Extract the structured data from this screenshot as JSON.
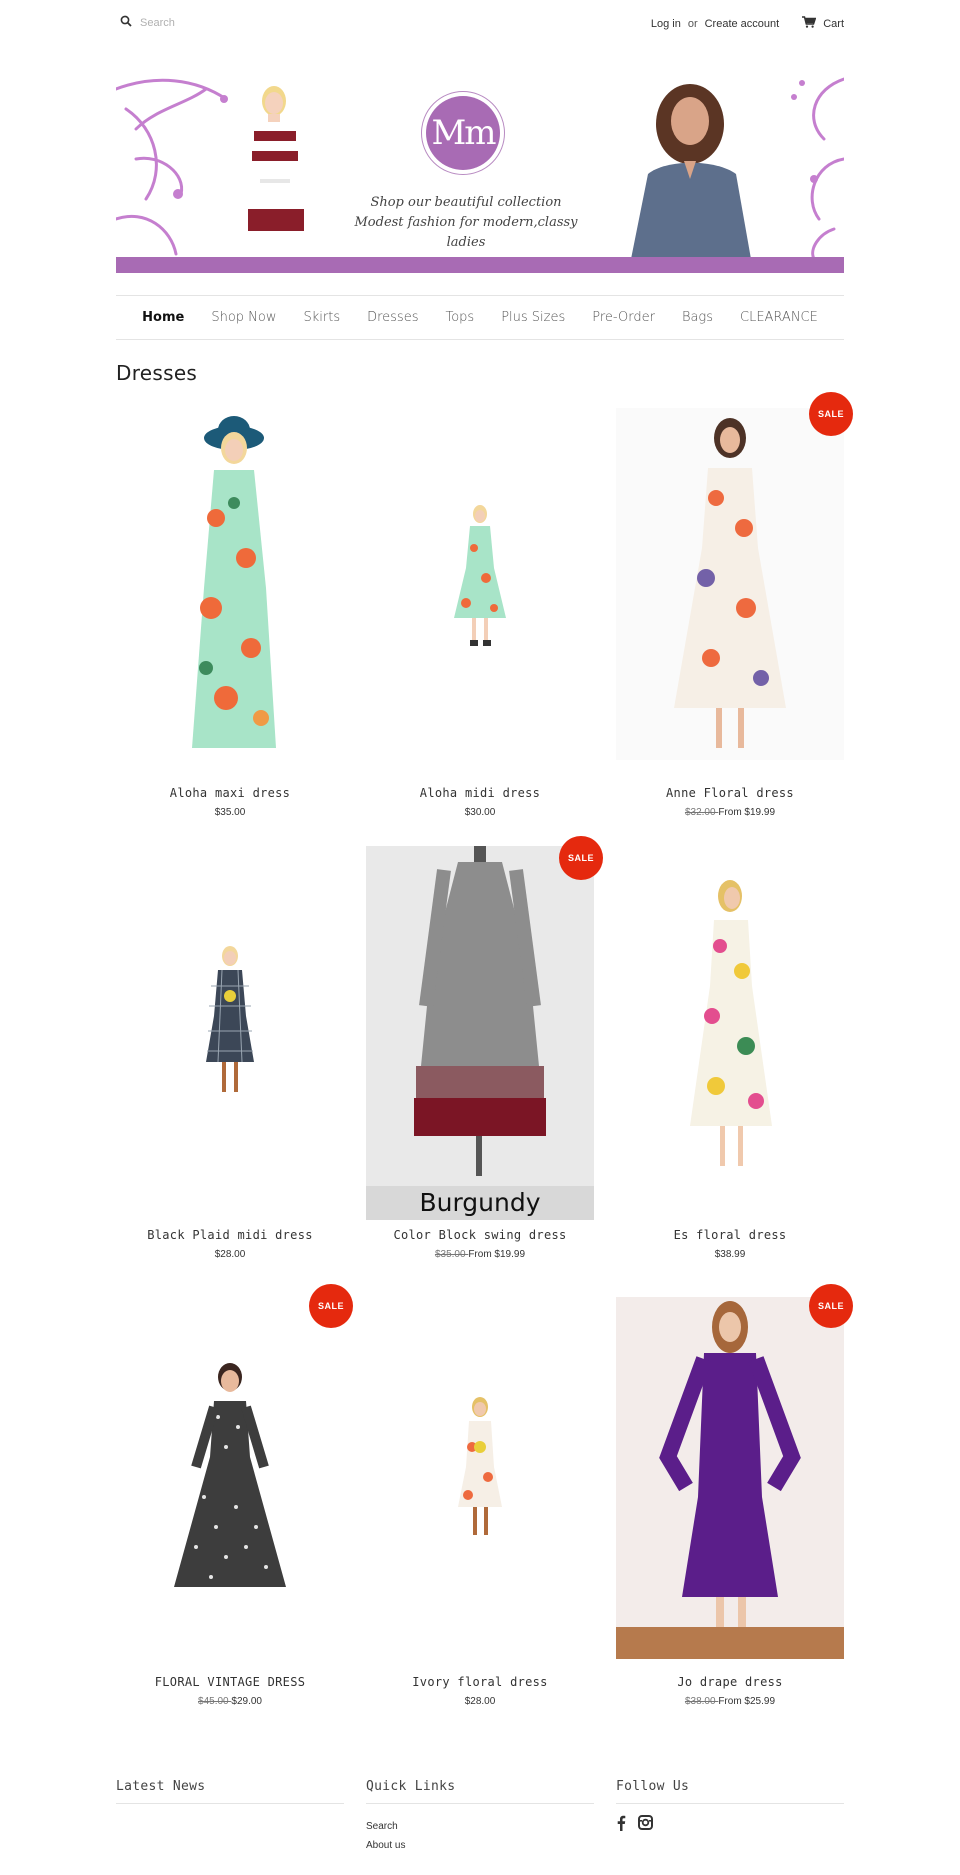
{
  "header": {
    "search_placeholder": "Search",
    "login": "Log in",
    "or": "or",
    "create_account": "Create account",
    "cart": "Cart"
  },
  "banner": {
    "logo_text": "Mm",
    "tagline_1": "Shop our beautiful collection",
    "tagline_2": "Modest fashion for modern,classy ladies",
    "accent": "#a86bb4"
  },
  "nav": {
    "items": [
      "Home",
      "Shop Now",
      "Skirts",
      "Dresses",
      "Tops",
      "Plus Sizes",
      "Pre-Order",
      "Bags",
      "CLEARANCE"
    ],
    "active": "Home"
  },
  "page_title": "Dresses",
  "sale_badge": "SALE",
  "sale_color": "#e5290e",
  "products": [
    {
      "name": "Aloha maxi dress",
      "price": "$35.00",
      "compare": "",
      "sale": false
    },
    {
      "name": "Aloha midi dress",
      "price": "$30.00",
      "compare": "",
      "sale": false
    },
    {
      "name": "Anne Floral dress",
      "price": "From $19.99",
      "compare": "$32.00",
      "sale": true
    },
    {
      "name": "Black Plaid midi dress",
      "price": "$28.00",
      "compare": "",
      "sale": false
    },
    {
      "name": "Color Block swing dress",
      "price": "From $19.99",
      "compare": "$35.00",
      "sale": true,
      "image_caption": "Burgundy"
    },
    {
      "name": "Es floral dress",
      "price": "$38.99",
      "compare": "",
      "sale": false
    },
    {
      "name": "FLORAL VINTAGE DRESS",
      "price": "$29.00",
      "compare": "$45.00",
      "sale": true
    },
    {
      "name": "Ivory floral dress",
      "price": "$28.00",
      "compare": "",
      "sale": false
    },
    {
      "name": "Jo drape dress",
      "price": "From $25.99",
      "compare": "$38.00",
      "sale": true
    }
  ],
  "footer": {
    "latest_news": "Latest News",
    "quick_links": "Quick Links",
    "quick_links_items": [
      "Search",
      "About us"
    ],
    "follow_us": "Follow Us"
  }
}
